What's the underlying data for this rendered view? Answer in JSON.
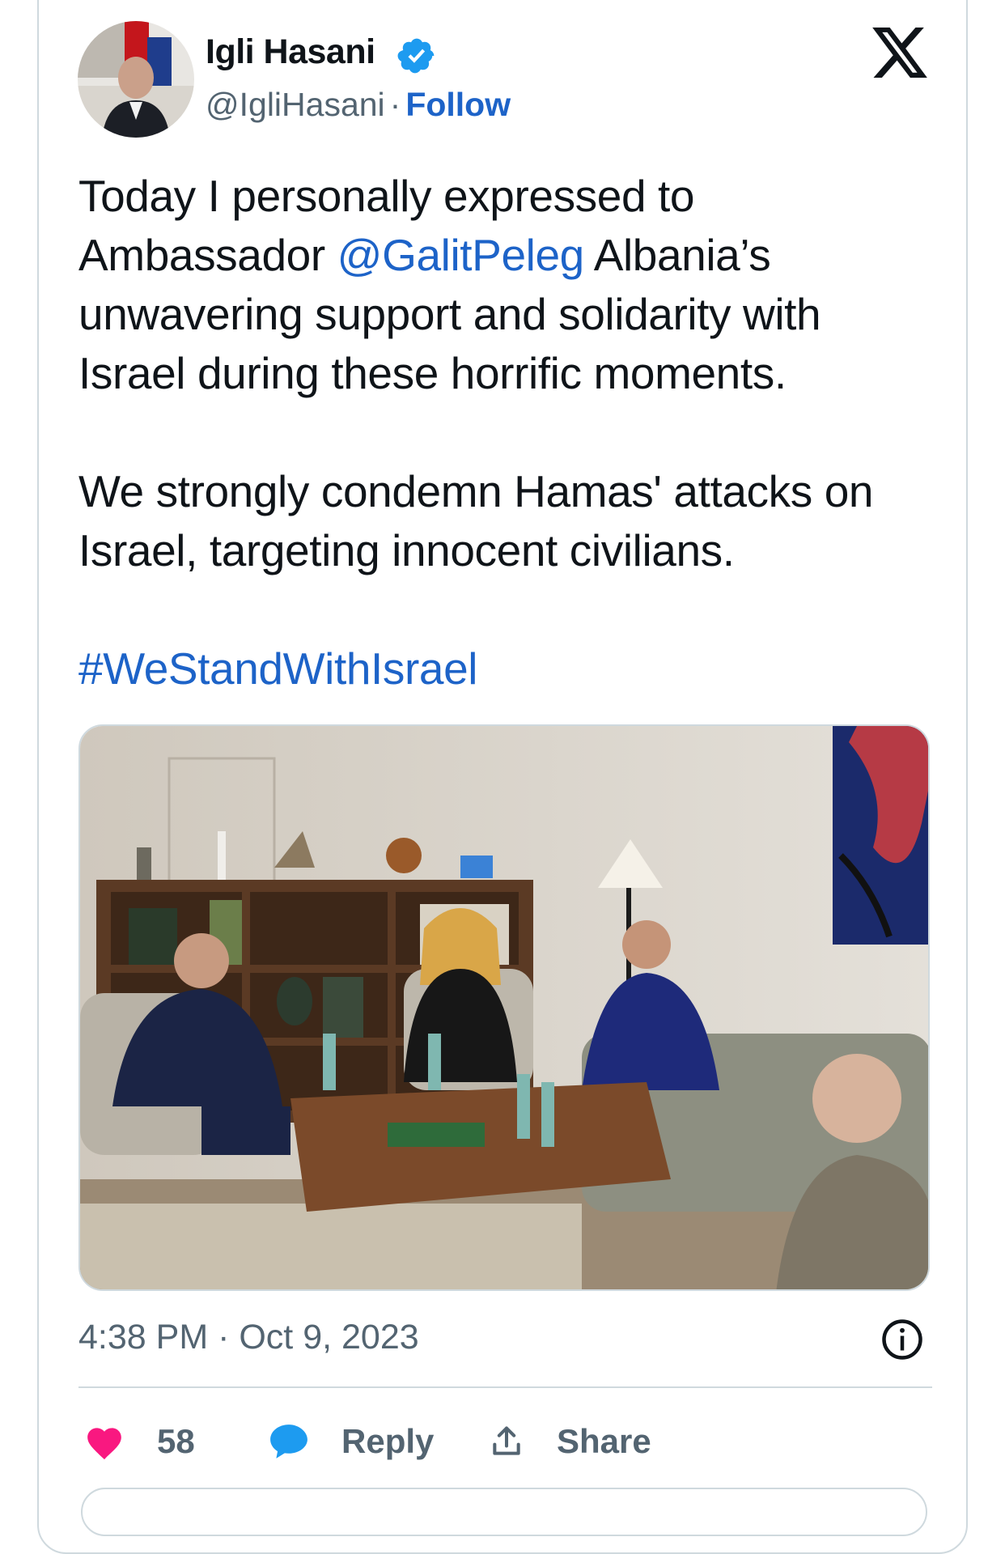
{
  "author": {
    "name": "Igli Hasani",
    "handle": "@IgliHasani",
    "separator": "·",
    "follow_label": "Follow",
    "verified": true
  },
  "tweet": {
    "p1_before": "Today I personally expressed to Ambassador ",
    "mention": "@GalitPeleg",
    "p1_after": " Albania’s unwavering support and solidarity with Israel during these horrific moments.",
    "p2": "We strongly condemn Hamas' attacks on Israel, targeting innocent civilians.",
    "hashtag": "#WeStandWithIsrael"
  },
  "meta": {
    "timestamp": "4:38 PM · Oct 9, 2023"
  },
  "actions": {
    "like_count": "58",
    "reply_label": "Reply",
    "share_label": "Share"
  },
  "colors": {
    "link": "#1d63c8",
    "like": "#f91880",
    "reply": "#1d9bf0",
    "muted": "#536471",
    "border": "#cfd9de"
  },
  "icons": [
    "verified-badge-icon",
    "x-logo-icon",
    "info-icon",
    "heart-icon",
    "reply-bubble-icon",
    "share-icon"
  ]
}
